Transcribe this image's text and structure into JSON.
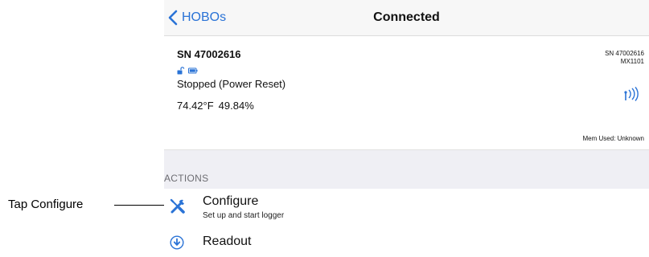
{
  "annotation": {
    "label": "Tap Configure"
  },
  "navbar": {
    "back_label": "HOBOs",
    "title": "Connected"
  },
  "device": {
    "serial": "SN 47002616",
    "state": "Stopped (Power Reset)",
    "temperature": "74.42°F",
    "humidity": "49.84%",
    "right_serial": "SN 47002616",
    "model": "MX1101",
    "memory": "Mem Used: Unknown",
    "icons": [
      "unlocked-lock-icon",
      "battery-icon",
      "bluetooth-signal-icon"
    ]
  },
  "actions": {
    "header": "ACTIONS",
    "items": [
      {
        "title": "Configure",
        "subtitle": "Set up and start logger",
        "icon": "wrench-screwdriver-icon"
      },
      {
        "title": "Readout",
        "icon": "download-circle-icon"
      }
    ]
  },
  "colors": {
    "accent": "#2a73d6",
    "group_background": "#efeff4",
    "navbar_background": "#f7f7f7"
  }
}
